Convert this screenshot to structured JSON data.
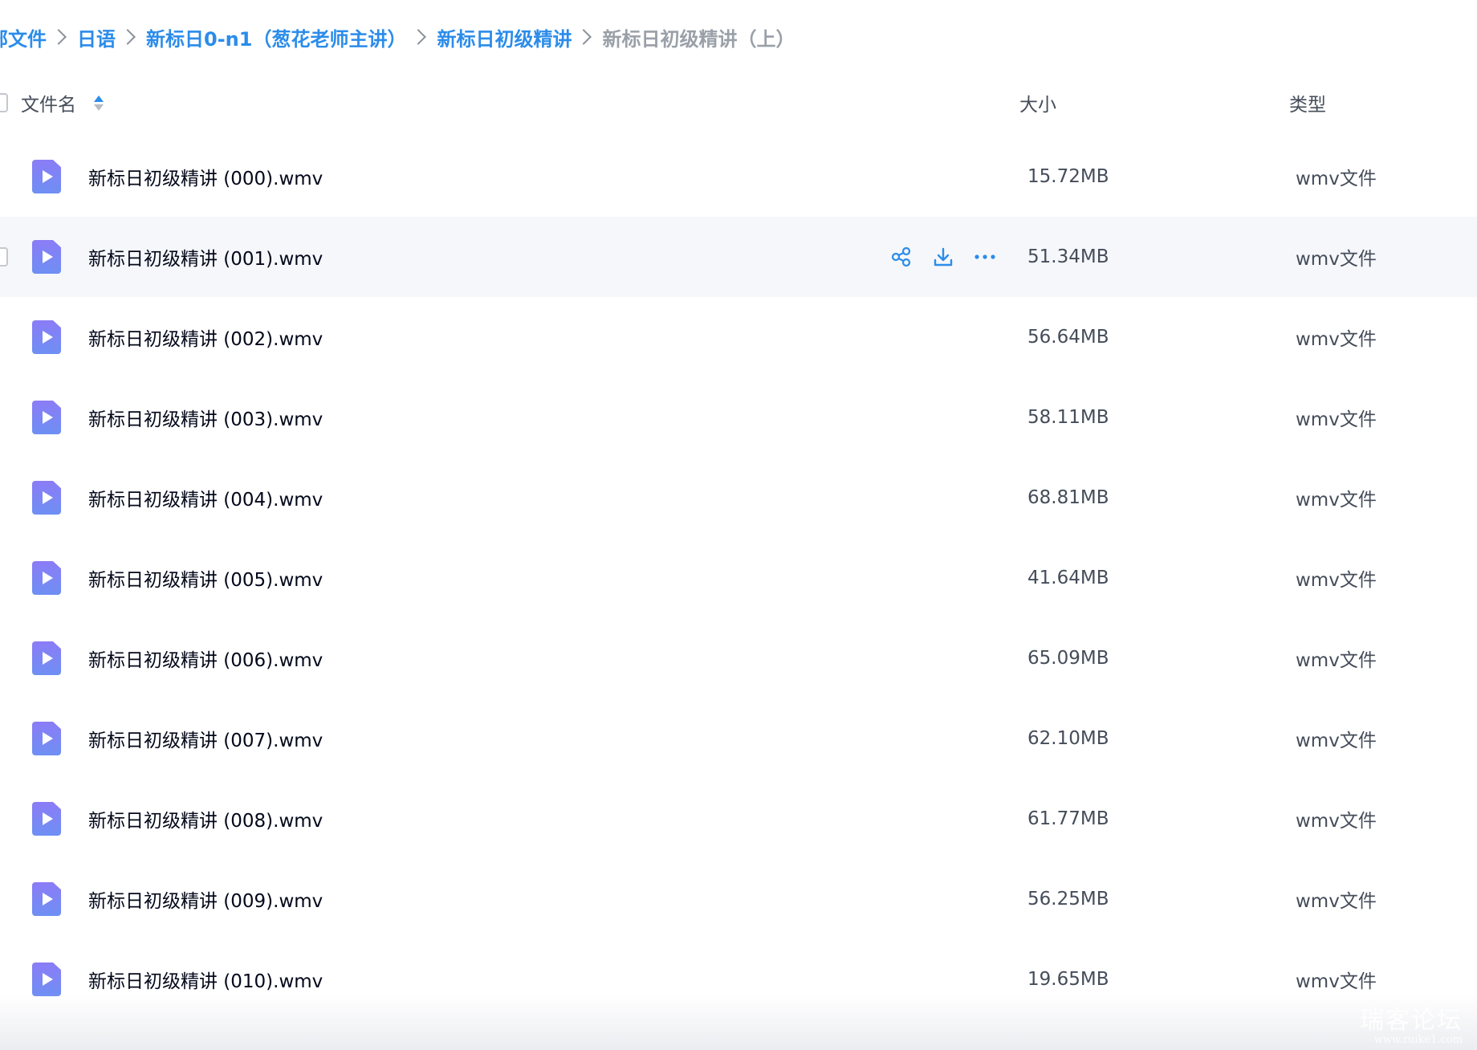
{
  "breadcrumb": {
    "items": [
      {
        "label": "部文件"
      },
      {
        "label": "日语"
      },
      {
        "label": "新标日0-n1（葱花老师主讲）"
      },
      {
        "label": "新标日初级精讲"
      },
      {
        "label": "新标日初级精讲（上）"
      }
    ]
  },
  "table": {
    "columns": {
      "name": "文件名",
      "size": "大小",
      "type": "类型"
    },
    "hover_row": 1,
    "rows": [
      {
        "name": "新标日初级精讲 (000).wmv",
        "size": "15.72MB",
        "type": "wmv文件"
      },
      {
        "name": "新标日初级精讲 (001).wmv",
        "size": "51.34MB",
        "type": "wmv文件"
      },
      {
        "name": "新标日初级精讲 (002).wmv",
        "size": "56.64MB",
        "type": "wmv文件"
      },
      {
        "name": "新标日初级精讲 (003).wmv",
        "size": "58.11MB",
        "type": "wmv文件"
      },
      {
        "name": "新标日初级精讲 (004).wmv",
        "size": "68.81MB",
        "type": "wmv文件"
      },
      {
        "name": "新标日初级精讲 (005).wmv",
        "size": "41.64MB",
        "type": "wmv文件"
      },
      {
        "name": "新标日初级精讲 (006).wmv",
        "size": "65.09MB",
        "type": "wmv文件"
      },
      {
        "name": "新标日初级精讲 (007).wmv",
        "size": "62.10MB",
        "type": "wmv文件"
      },
      {
        "name": "新标日初级精讲 (008).wmv",
        "size": "61.77MB",
        "type": "wmv文件"
      },
      {
        "name": "新标日初级精讲 (009).wmv",
        "size": "56.25MB",
        "type": "wmv文件"
      },
      {
        "name": "新标日初级精讲 (010).wmv",
        "size": "19.65MB",
        "type": "wmv文件"
      }
    ]
  },
  "icons": {
    "file": "video-file-icon",
    "share": "share-icon",
    "download": "download-icon",
    "more": "more-icon",
    "sort": "sort-icon"
  },
  "colors": {
    "link": "#2b8cea",
    "current_crumb": "#9aa0a8",
    "hover_row_bg": "#f5f7fb",
    "text": "#03081a",
    "muted": "#454d5a"
  },
  "watermark": {
    "main": "瑞客论坛",
    "url": "www.ruike1.com"
  }
}
